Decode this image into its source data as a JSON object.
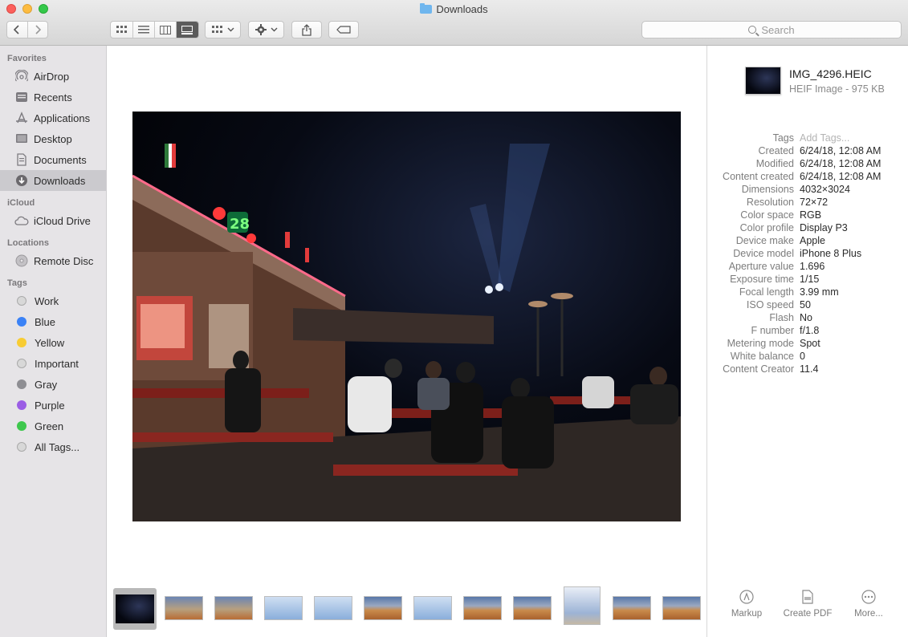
{
  "window": {
    "title": "Downloads"
  },
  "toolbar": {
    "back_label": "<",
    "forward_label": ">",
    "search_placeholder": "Search"
  },
  "sidebar": {
    "favorites_header": "Favorites",
    "favorites": [
      {
        "label": "AirDrop",
        "icon": "airdrop-icon"
      },
      {
        "label": "Recents",
        "icon": "recents-icon"
      },
      {
        "label": "Applications",
        "icon": "applications-icon"
      },
      {
        "label": "Desktop",
        "icon": "desktop-icon"
      },
      {
        "label": "Documents",
        "icon": "documents-icon"
      },
      {
        "label": "Downloads",
        "icon": "downloads-icon",
        "selected": true
      }
    ],
    "icloud_header": "iCloud",
    "icloud": [
      {
        "label": "iCloud Drive",
        "icon": "cloud-icon"
      }
    ],
    "locations_header": "Locations",
    "locations": [
      {
        "label": "Remote Disc",
        "icon": "disc-icon"
      }
    ],
    "tags_header": "Tags",
    "tags": [
      {
        "label": "Work",
        "color": "#d8d8d8"
      },
      {
        "label": "Blue",
        "color": "#3b82f6"
      },
      {
        "label": "Yellow",
        "color": "#f8cc33"
      },
      {
        "label": "Important",
        "color": "#d8d8d8"
      },
      {
        "label": "Gray",
        "color": "#8e8e93"
      },
      {
        "label": "Purple",
        "color": "#9b5de5"
      },
      {
        "label": "Green",
        "color": "#3ec74d"
      },
      {
        "label": "All Tags...",
        "color": "#d8d8d8"
      }
    ]
  },
  "inspector": {
    "file_name": "IMG_4296.HEIC",
    "file_kind": "HEIF Image - 975 KB",
    "metadata": [
      {
        "key": "Tags",
        "value": "Add Tags...",
        "placeholder": true
      },
      {
        "key": "Created",
        "value": "6/24/18, 12:08 AM"
      },
      {
        "key": "Modified",
        "value": "6/24/18, 12:08 AM"
      },
      {
        "key": "Content created",
        "value": "6/24/18, 12:08 AM"
      },
      {
        "key": "Dimensions",
        "value": "4032×3024"
      },
      {
        "key": "Resolution",
        "value": "72×72"
      },
      {
        "key": "Color space",
        "value": "RGB"
      },
      {
        "key": "Color profile",
        "value": "Display P3"
      },
      {
        "key": "Device make",
        "value": "Apple"
      },
      {
        "key": "Device model",
        "value": "iPhone 8 Plus"
      },
      {
        "key": "Aperture value",
        "value": "1.696"
      },
      {
        "key": "Exposure time",
        "value": "1/15"
      },
      {
        "key": "Focal length",
        "value": "3.99 mm"
      },
      {
        "key": "ISO speed",
        "value": "50"
      },
      {
        "key": "Flash",
        "value": "No"
      },
      {
        "key": "F number",
        "value": "f/1.8"
      },
      {
        "key": "Metering mode",
        "value": "Spot"
      },
      {
        "key": "White balance",
        "value": "0"
      },
      {
        "key": "Content Creator",
        "value": "11.4"
      }
    ],
    "actions": [
      {
        "label": "Markup",
        "icon": "markup-icon"
      },
      {
        "label": "Create PDF",
        "icon": "create-pdf-icon"
      },
      {
        "label": "More...",
        "icon": "more-icon"
      }
    ]
  },
  "photo_sign_text": "28"
}
